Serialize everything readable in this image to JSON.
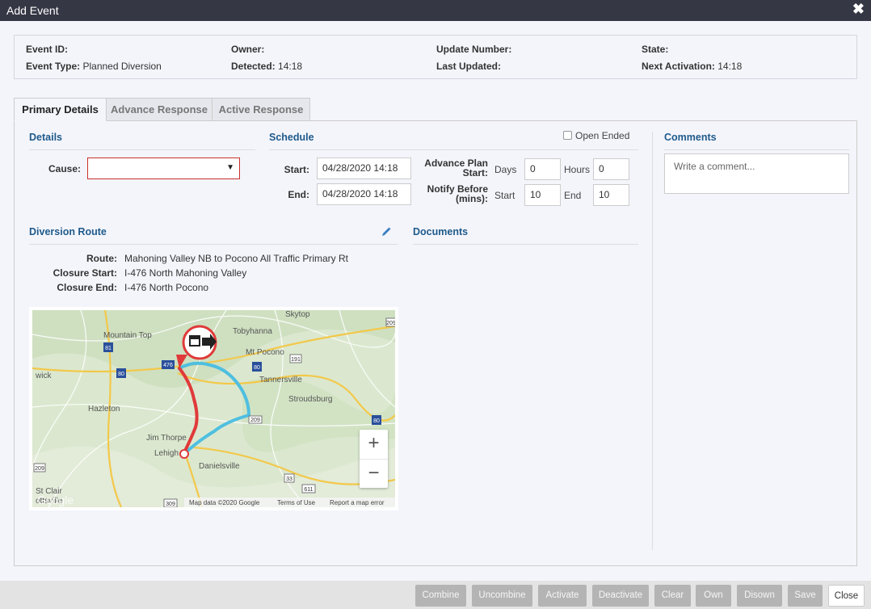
{
  "window": {
    "title": "Add Event",
    "close_glyph": "✖",
    "close_icon": "close-icon"
  },
  "summary": {
    "event_id_label": "Event ID:",
    "event_id_value": "",
    "event_type_label": "Event Type:",
    "event_type_value": "Planned Diversion",
    "owner_label": "Owner:",
    "owner_value": "",
    "detected_label": "Detected:",
    "detected_value": "14:18",
    "update_number_label": "Update Number:",
    "update_number_value": "",
    "last_updated_label": "Last Updated:",
    "last_updated_value": "",
    "state_label": "State:",
    "state_value": "",
    "next_activation_label": "Next Activation:",
    "next_activation_value": "14:18"
  },
  "tabs": [
    {
      "label": "Primary Details",
      "active": true
    },
    {
      "label": "Advance Response",
      "active": false
    },
    {
      "label": "Active Response",
      "active": false
    }
  ],
  "details": {
    "title": "Details",
    "cause_label": "Cause:",
    "cause_value": ""
  },
  "schedule": {
    "title": "Schedule",
    "open_ended_label": "Open Ended",
    "open_ended_checked": false,
    "start_label": "Start:",
    "start_value": "04/28/2020 14:18",
    "end_label": "End:",
    "end_value": "04/28/2020 14:18",
    "advance_plan_label_1": "Advance Plan",
    "advance_plan_label_2": "Start:",
    "days_label": "Days",
    "days_value": "0",
    "hours_label": "Hours",
    "hours_value": "0",
    "notify_label_1": "Notify Before",
    "notify_label_2": "(mins):",
    "notify_start_label": "Start",
    "notify_start_value": "10",
    "notify_end_label": "End",
    "notify_end_value": "10"
  },
  "comments": {
    "title": "Comments",
    "placeholder": "Write a comment..."
  },
  "diversion": {
    "title": "Diversion Route",
    "route_label": "Route:",
    "route_value": "Mahoning Valley NB to Pocono All Traffic Primary Rt",
    "closure_start_label": "Closure Start:",
    "closure_start_value": "I-476 North Mahoning Valley",
    "closure_end_label": "Closure End:",
    "closure_end_value": "I-476 North Pocono",
    "edit_icon": "pencil-icon"
  },
  "documents": {
    "title": "Documents"
  },
  "map": {
    "places": [
      "Skytop",
      "Mountain Top",
      "Tobyhanna",
      "Mt Pocono",
      "wick",
      "Tannersville",
      "Stroudsburg",
      "Hazleton",
      "Jim Thorpe",
      "Lehigh",
      "Danielsville",
      "St Clair",
      "ottsville"
    ],
    "shields": [
      "209",
      "81",
      "476",
      "80",
      "191",
      "80",
      "209",
      "80",
      "33",
      "611",
      "209",
      "309"
    ],
    "attribution": [
      "Map data ©2020 Google",
      "Terms of Use",
      "Report a map error"
    ],
    "google_logo": "Google",
    "zoom_in": "+",
    "zoom_out": "−",
    "route_color": "#e03a3a",
    "alt_route_color": "#4fbfe0"
  },
  "footer": {
    "buttons": [
      "Combine",
      "Uncombine",
      "Activate",
      "Deactivate",
      "Clear",
      "Own",
      "Disown",
      "Save",
      "Close"
    ]
  },
  "colors": {
    "section_title": "#1f5a8b",
    "titlebar": "#353745",
    "disabled_button": "#b4b4b4",
    "error_border": "#c9302c"
  }
}
